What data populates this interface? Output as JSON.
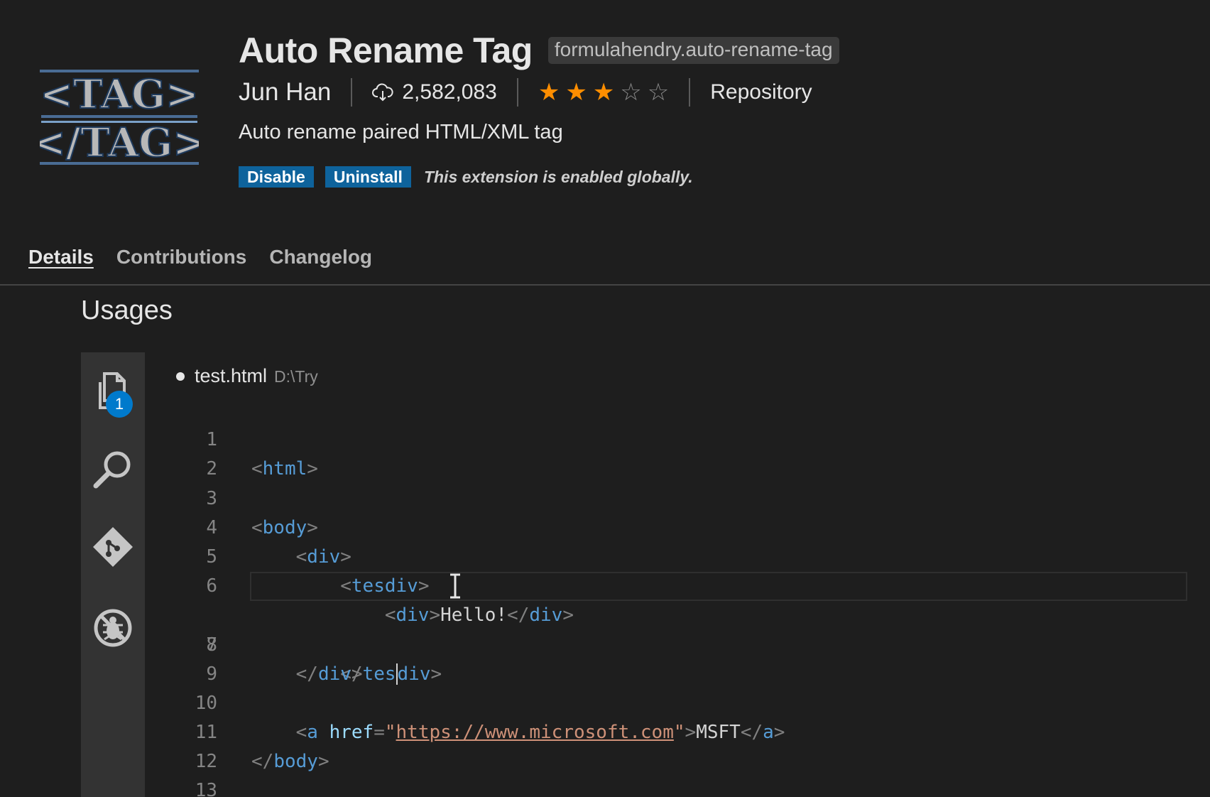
{
  "extension": {
    "name": "Auto Rename Tag",
    "identifier": "formulahendry.auto-rename-tag",
    "publisher": "Jun Han",
    "install_count": "2,582,083",
    "rating": {
      "filled": 3,
      "max": 5
    },
    "repository_label": "Repository",
    "description": "Auto rename paired HTML/XML tag",
    "disable_label": "Disable",
    "uninstall_label": "Uninstall",
    "status_text": "This extension is enabled globally.",
    "logo_text": [
      "<TAG>",
      "</TAG>"
    ]
  },
  "tabs": [
    {
      "label": "Details",
      "active": true
    },
    {
      "label": "Contributions",
      "active": false
    },
    {
      "label": "Changelog",
      "active": false
    }
  ],
  "content": {
    "heading": "Usages",
    "editor": {
      "file_name": "test.html",
      "file_path": "D:\\Try",
      "explorer_badge": "1",
      "current_line": 7,
      "lines": [
        {
          "n": "1"
        },
        {
          "n": "2"
        },
        {
          "n": "3"
        },
        {
          "n": "4"
        },
        {
          "n": "5"
        },
        {
          "n": "6"
        },
        {
          "n": "7"
        },
        {
          "n": "8"
        },
        {
          "n": "9"
        },
        {
          "n": "10"
        },
        {
          "n": "11"
        },
        {
          "n": "12"
        },
        {
          "n": "13"
        }
      ],
      "tokens": {
        "html": "html",
        "body": "body",
        "div": "div",
        "tesdiv": "tesdiv",
        "tes": "tes",
        "hello": "Hello!",
        "a": "a",
        "href": "href",
        "url": "https://www.microsoft.com",
        "msft": "MSFT"
      }
    }
  },
  "colors": {
    "accent_button": "#0e639c",
    "star": "#ff8e00",
    "badge": "#007acc",
    "tag": "#569cd6",
    "string": "#ce9178",
    "attribute": "#9cdcfe"
  },
  "icons": {
    "activity_bar": [
      "files-icon",
      "search-icon",
      "source-control-icon",
      "debug-icon"
    ],
    "installs": "cloud-download-icon"
  }
}
